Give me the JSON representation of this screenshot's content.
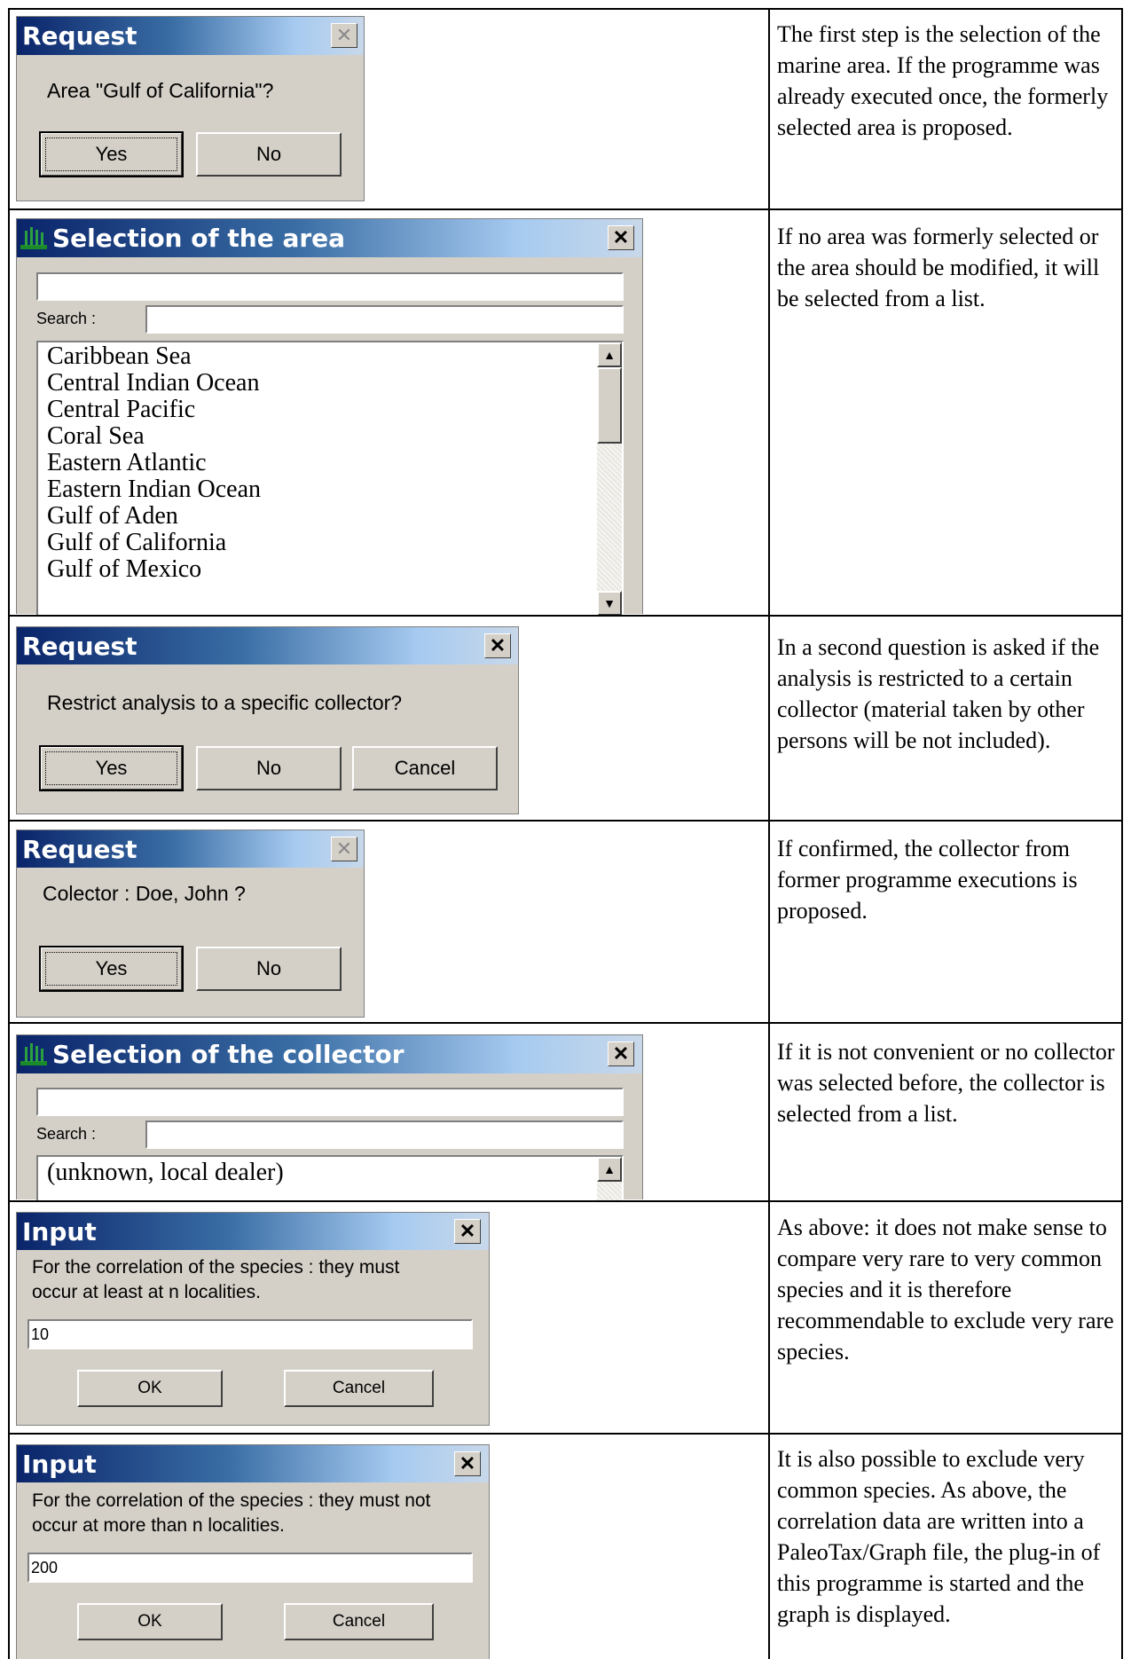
{
  "rows": [
    {
      "description": "The first step is the selection of the marine area. If the programme was already executed once, the formerly selected area is proposed.",
      "dialog": {
        "title": "Request",
        "message": "Area \"Gulf of California\"?",
        "buttons": [
          "Yes",
          "No"
        ]
      }
    },
    {
      "description": "If no area was formerly selected or the area should be modified, it will be selected from a list.",
      "dialog": {
        "title": "Selection of the area",
        "top_field_value": "",
        "search_label": "Search :",
        "search_value": "",
        "list_items": [
          "Caribbean Sea",
          "Central Indian Ocean",
          "Central Pacific",
          "Coral Sea",
          "Eastern Atlantic",
          "Eastern Indian Ocean",
          "Gulf of Aden",
          "Gulf of California",
          "Gulf of Mexico"
        ]
      }
    },
    {
      "description": "In a second question is asked if the analysis is restricted to a certain collector (material taken by other persons will be not included).",
      "dialog": {
        "title": "Request",
        "message": "Restrict analysis to a specific collector?",
        "buttons": [
          "Yes",
          "No",
          "Cancel"
        ]
      }
    },
    {
      "description": "If confirmed, the collector from former programme executions is proposed.",
      "dialog": {
        "title": "Request",
        "message": "Colector : Doe, John ?",
        "buttons": [
          "Yes",
          "No"
        ]
      }
    },
    {
      "description": "If it is not convenient or no collector was selected before, the collector is selected from a list.",
      "dialog": {
        "title": "Selection of the collector",
        "top_field_value": "",
        "search_label": "Search :",
        "search_value": "",
        "list_items": [
          "(unknown, local dealer)"
        ]
      }
    },
    {
      "description": "As above: it does not make sense to compare very rare to very common species and it is therefore recommendable to exclude very rare species.",
      "dialog": {
        "title": "Input",
        "message_line1": "For the correlation of the species : they must",
        "message_line2": "occur at least at n localities.",
        "input_value": "10",
        "buttons": [
          "OK",
          "Cancel"
        ]
      }
    },
    {
      "description": "It is also possible to exclude very common species. As above, the correlation data are written into a PaleoTax/Graph file, the plug-in of this programme is started and the graph is displayed.",
      "dialog": {
        "title": "Input",
        "message_line1": "For the correlation of the species : they must not",
        "message_line2": "occur at more than n localities.",
        "input_value": "200",
        "buttons": [
          "OK",
          "Cancel"
        ]
      }
    }
  ],
  "icons": {
    "close": "close-icon",
    "app": "app-icon",
    "scroll_up": "scroll-up-arrow-icon",
    "scroll_down": "scroll-down-arrow-icon"
  }
}
